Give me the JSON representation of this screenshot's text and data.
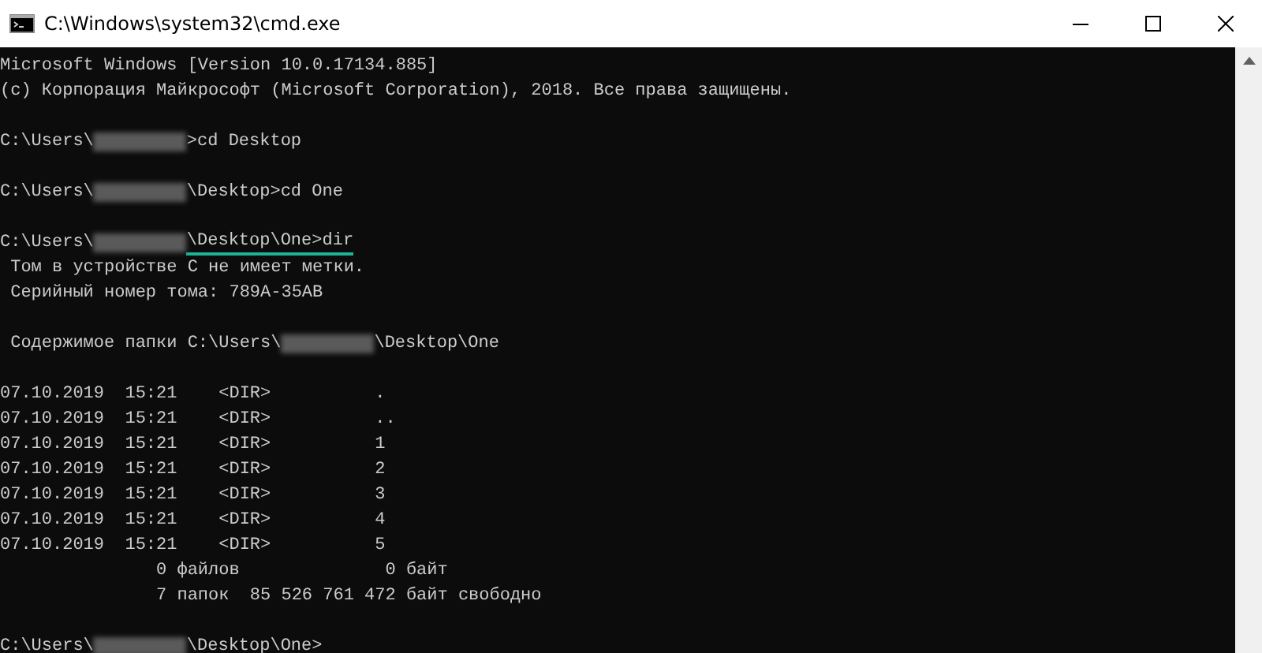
{
  "window": {
    "title": "C:\\Windows\\system32\\cmd.exe"
  },
  "console": {
    "lines": [
      {
        "kind": "text",
        "parts": [
          {
            "kind": "text",
            "text": "Microsoft Windows [Version 10.0.17134.885]"
          }
        ]
      },
      {
        "kind": "text",
        "parts": [
          {
            "kind": "text",
            "text": "(c) Корпорация Майкрософт (Microsoft Corporation), 2018. Все права защищены."
          }
        ]
      },
      {
        "kind": "blank"
      },
      {
        "kind": "text",
        "parts": [
          {
            "kind": "text",
            "text": "C:\\Users\\"
          },
          {
            "kind": "redacted"
          },
          {
            "kind": "text",
            "text": ">cd Desktop"
          }
        ]
      },
      {
        "kind": "blank"
      },
      {
        "kind": "text",
        "parts": [
          {
            "kind": "text",
            "text": "C:\\Users\\"
          },
          {
            "kind": "redacted"
          },
          {
            "kind": "text",
            "text": "\\Desktop>cd One"
          }
        ]
      },
      {
        "kind": "blank"
      },
      {
        "kind": "text",
        "parts": [
          {
            "kind": "text",
            "text": "C:\\Users\\"
          },
          {
            "kind": "redacted"
          },
          {
            "kind": "underlined",
            "text": "\\Desktop\\One>dir"
          }
        ]
      },
      {
        "kind": "text",
        "parts": [
          {
            "kind": "text",
            "text": " Том в устройстве C не имеет метки."
          }
        ]
      },
      {
        "kind": "text",
        "parts": [
          {
            "kind": "text",
            "text": " Серийный номер тома: 789A-35AB"
          }
        ]
      },
      {
        "kind": "blank"
      },
      {
        "kind": "text",
        "parts": [
          {
            "kind": "text",
            "text": " Содержимое папки C:\\Users\\"
          },
          {
            "kind": "redacted"
          },
          {
            "kind": "text",
            "text": "\\Desktop\\One"
          }
        ]
      },
      {
        "kind": "blank"
      },
      {
        "kind": "text",
        "parts": [
          {
            "kind": "text",
            "text": "07.10.2019  15:21    <DIR>          ."
          }
        ]
      },
      {
        "kind": "text",
        "parts": [
          {
            "kind": "text",
            "text": "07.10.2019  15:21    <DIR>          .."
          }
        ]
      },
      {
        "kind": "text",
        "parts": [
          {
            "kind": "text",
            "text": "07.10.2019  15:21    <DIR>          1"
          }
        ]
      },
      {
        "kind": "text",
        "parts": [
          {
            "kind": "text",
            "text": "07.10.2019  15:21    <DIR>          2"
          }
        ]
      },
      {
        "kind": "text",
        "parts": [
          {
            "kind": "text",
            "text": "07.10.2019  15:21    <DIR>          3"
          }
        ]
      },
      {
        "kind": "text",
        "parts": [
          {
            "kind": "text",
            "text": "07.10.2019  15:21    <DIR>          4"
          }
        ]
      },
      {
        "kind": "text",
        "parts": [
          {
            "kind": "text",
            "text": "07.10.2019  15:21    <DIR>          5"
          }
        ]
      },
      {
        "kind": "text",
        "parts": [
          {
            "kind": "text",
            "text": "               0 файлов              0 байт"
          }
        ]
      },
      {
        "kind": "text",
        "parts": [
          {
            "kind": "text",
            "text": "               7 папок  85 526 761 472 байт свободно"
          }
        ]
      },
      {
        "kind": "blank"
      },
      {
        "kind": "text",
        "parts": [
          {
            "kind": "text",
            "text": "C:\\Users\\"
          },
          {
            "kind": "redacted"
          },
          {
            "kind": "text",
            "text": "\\Desktop\\One>"
          }
        ]
      }
    ]
  }
}
